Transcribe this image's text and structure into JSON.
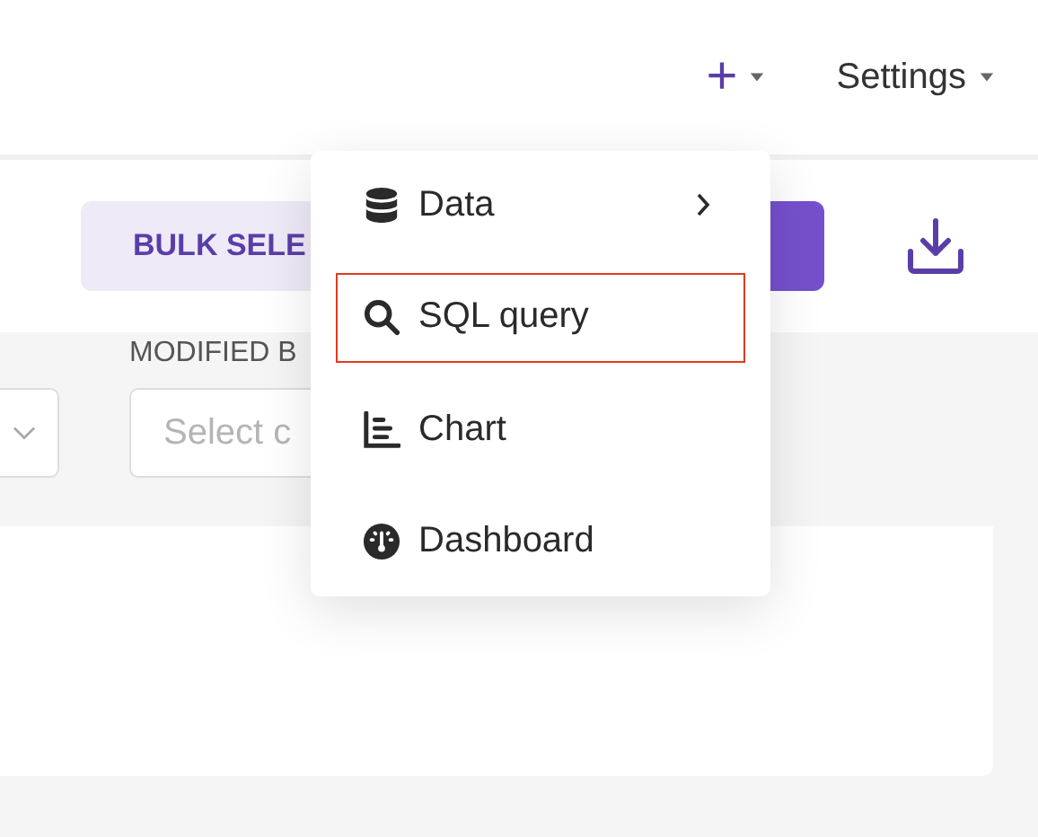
{
  "top_bar": {
    "add_menu": {
      "label": "+",
      "expanded": true
    },
    "settings": {
      "label": "Settings"
    }
  },
  "toolbar": {
    "bulk_select": "BULK SELE"
  },
  "filters": [
    {
      "kind": "select"
    },
    {
      "kind": "select",
      "label": "MODIFIED B",
      "placeholder": "Select c"
    }
  ],
  "add_menu_items": [
    {
      "kind": "data",
      "label": "Data",
      "submenu": true,
      "selected": false
    },
    {
      "kind": "query",
      "label": "SQL query",
      "submenu": false,
      "selected": true
    },
    {
      "kind": "chart",
      "label": "Chart",
      "submenu": false,
      "selected": false
    },
    {
      "kind": "dashboard",
      "label": "Dashboard",
      "submenu": false,
      "selected": false
    }
  ]
}
